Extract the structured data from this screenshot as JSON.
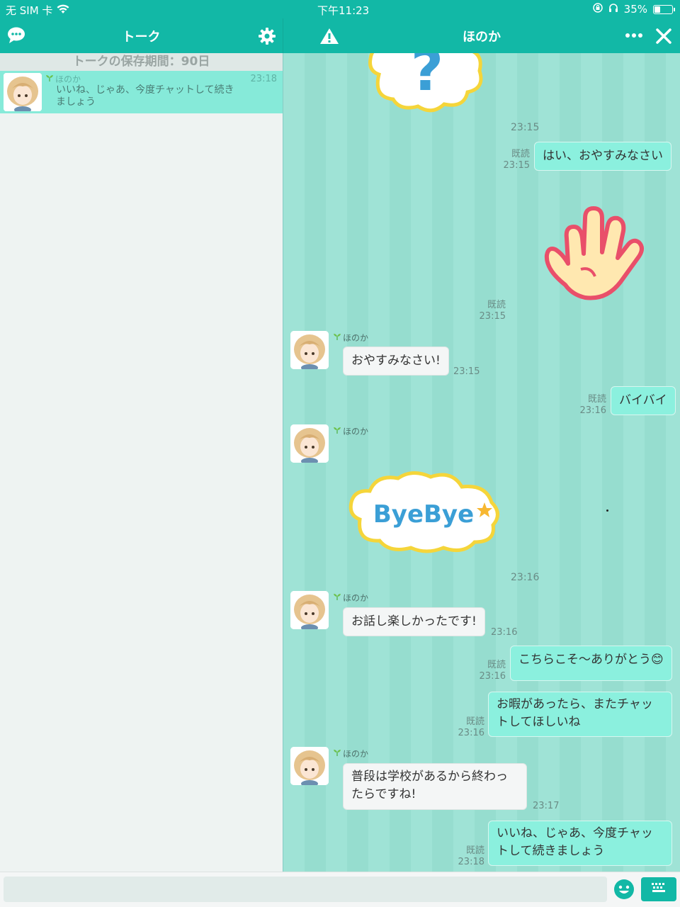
{
  "status_bar": {
    "carrier": "无 SIM 卡",
    "time": "下午11:23",
    "battery": "35%",
    "battery_level": 0.35
  },
  "left_nav": {
    "title": "トーク"
  },
  "right_nav": {
    "title": "ほのか"
  },
  "left_pane": {
    "retention": "トークの保存期間：90日",
    "talk_item": {
      "name": "ほのか",
      "time": "23:18",
      "preview": "いいね、じゃあ、今度チャットして続きましょう"
    }
  },
  "chat": {
    "time_stamp1": "23:15",
    "msg1": {
      "read": "既読",
      "time": "23:15",
      "text": "はい、おやすみなさい"
    },
    "stamp2_meta": {
      "read": "既読",
      "time": "23:15"
    },
    "msg3": {
      "sender": "ほのか",
      "text": "おやすみなさい!",
      "time": "23:15"
    },
    "msg4": {
      "read": "既読",
      "time": "23:16",
      "text": "バイバイ"
    },
    "msg5": {
      "sender": "ほのか",
      "stamp_text": "ByeBye",
      "time": "23:16"
    },
    "msg6": {
      "sender": "ほのか",
      "text": "お話し楽しかったです!",
      "time": "23:16"
    },
    "msg7": {
      "read": "既読",
      "time": "23:16",
      "text": "こちらこそ〜ありがとう😊"
    },
    "msg8": {
      "read": "既読",
      "time": "23:16",
      "text": "お暇があったら、またチャットしてほしいね"
    },
    "msg9": {
      "sender": "ほのか",
      "text": "普段は学校があるから終わったらですね!",
      "time": "23:17"
    },
    "msg10": {
      "read": "既読",
      "time": "23:18",
      "text": "いいね、じゃあ、今度チャットして続きましょう"
    }
  },
  "input": {
    "placeholder": ""
  },
  "colors": {
    "brand": "#12b8a6",
    "chat_bg": "#9fe3d6",
    "bubble_out": "#8bf0de",
    "bubble_in": "#f4f6f6"
  }
}
